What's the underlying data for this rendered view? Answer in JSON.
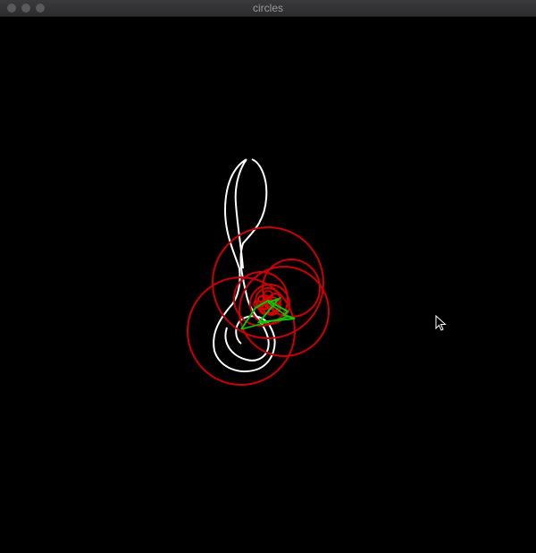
{
  "window": {
    "title": "circles"
  },
  "drawing": {
    "background_color": "#000000",
    "figure_stroke_color": "#ffffff",
    "circle_color": "#cc0000",
    "vector_color": "#00cc00"
  },
  "icons": {
    "close": "window-close-icon",
    "minimize": "window-minimize-icon",
    "zoom": "window-zoom-icon",
    "cursor": "mouse-pointer-icon"
  }
}
